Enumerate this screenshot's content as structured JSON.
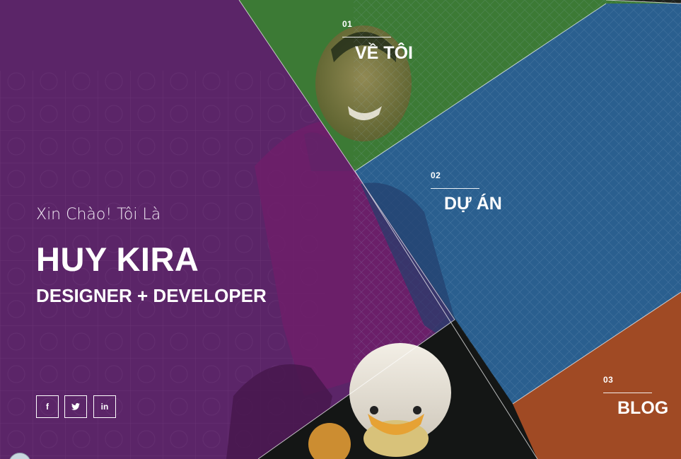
{
  "hero": {
    "greeting": "Xin Chào! Tôi Là",
    "name": "HUY KIRA",
    "role": "DESIGNER + DEVELOPER"
  },
  "nav": [
    {
      "number": "01",
      "label": "VỀ TÔI",
      "color": "#3c7a35"
    },
    {
      "number": "02",
      "label": "DỰ ÁN",
      "color": "#2a5f8f"
    },
    {
      "number": "03",
      "label": "BLOG",
      "color": "#a04a24"
    }
  ],
  "social": [
    {
      "icon": "facebook-icon",
      "glyph": "f"
    },
    {
      "icon": "twitter-icon",
      "glyph": "t"
    },
    {
      "icon": "linkedin-icon",
      "glyph": "in"
    }
  ],
  "colors": {
    "purple_panel": "#5b2568",
    "green_panel": "#3c7a35",
    "blue_panel": "#2a5f8f",
    "orange_panel": "#a04a24",
    "text": "#ffffff"
  }
}
